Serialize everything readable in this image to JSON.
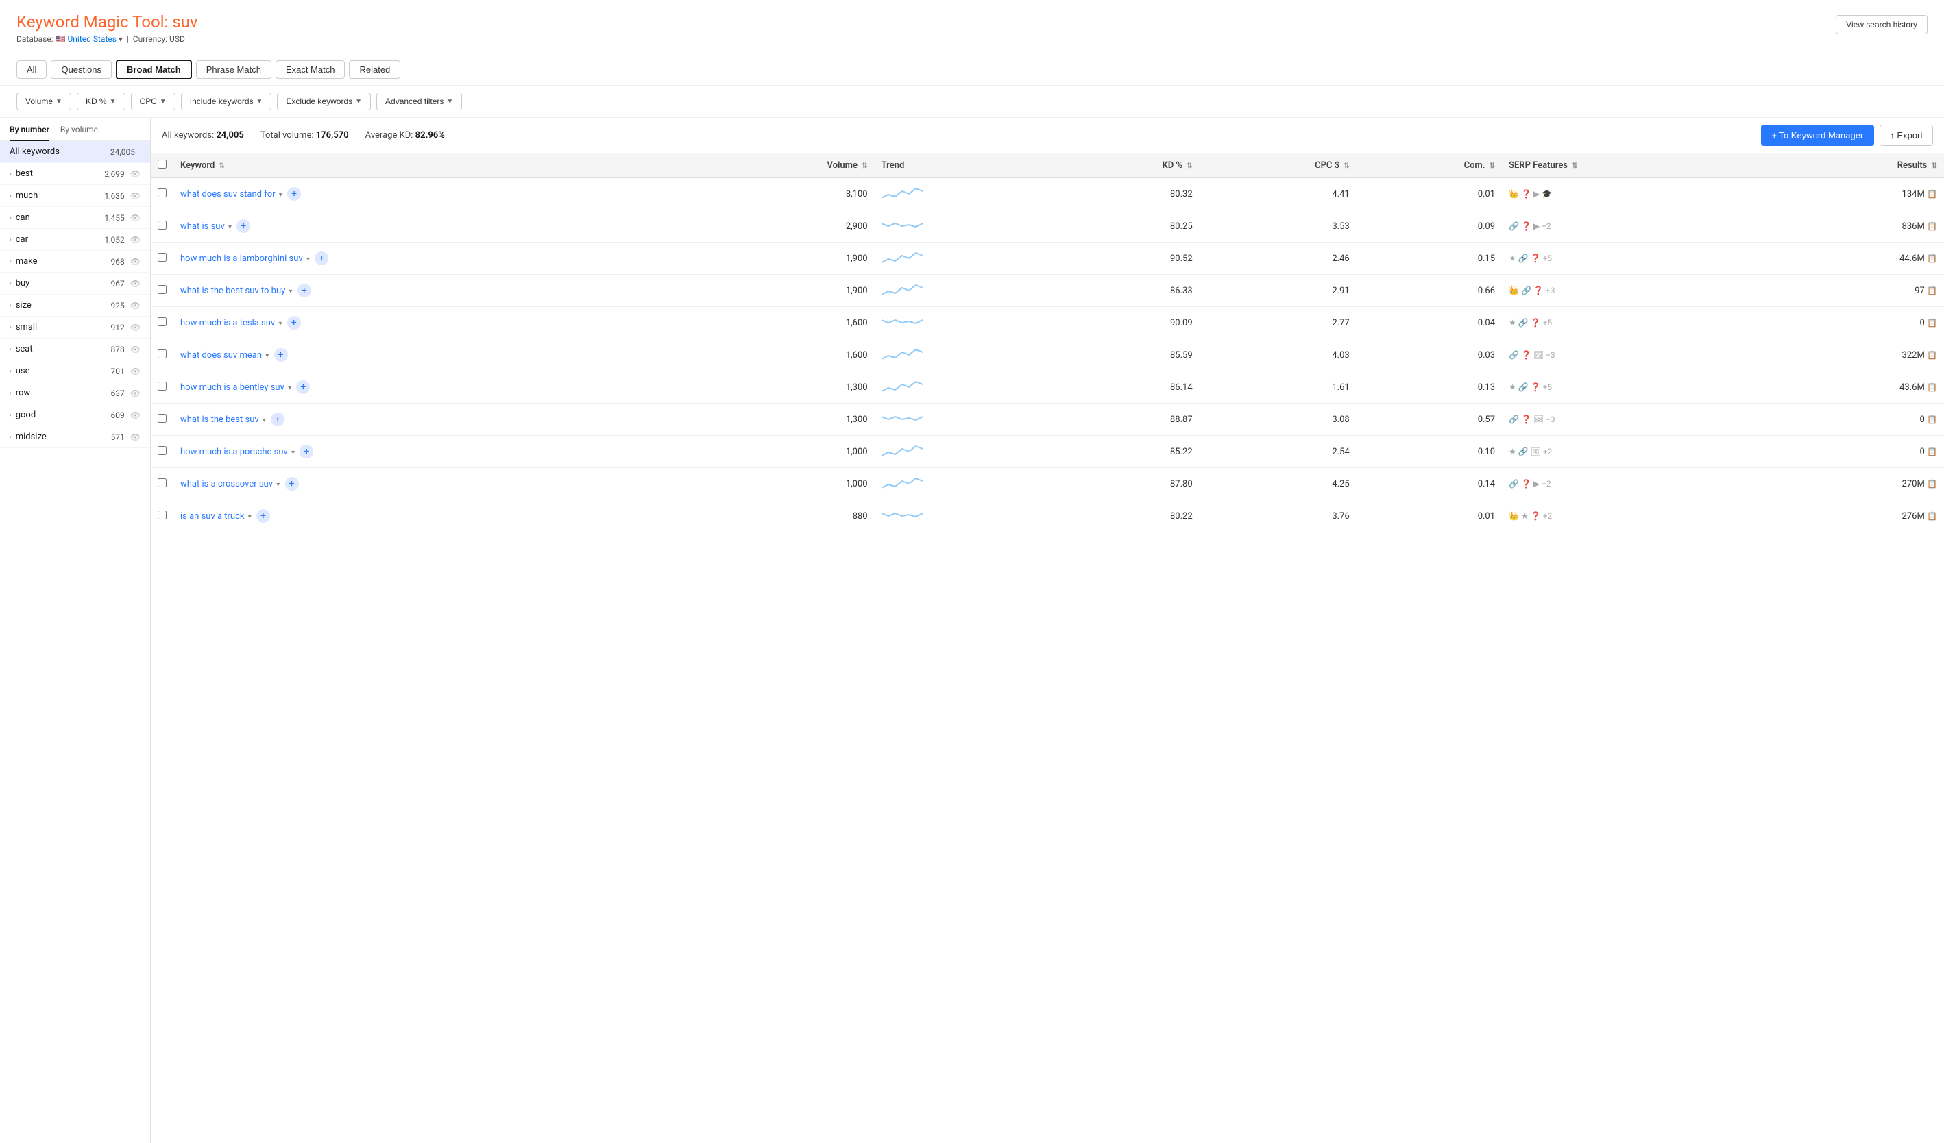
{
  "header": {
    "title_prefix": "Keyword Magic Tool: ",
    "title_keyword": "suv",
    "database_label": "Database:",
    "database_value": "United States",
    "currency_label": "Currency: USD",
    "view_history_btn": "View search history"
  },
  "tabs": [
    {
      "id": "all",
      "label": "All",
      "active": false
    },
    {
      "id": "questions",
      "label": "Questions",
      "active": true
    },
    {
      "id": "broad",
      "label": "Broad Match",
      "active": true
    },
    {
      "id": "phrase",
      "label": "Phrase Match",
      "active": false
    },
    {
      "id": "exact",
      "label": "Exact Match",
      "active": false
    },
    {
      "id": "related",
      "label": "Related",
      "active": false
    }
  ],
  "filters": [
    {
      "id": "volume",
      "label": "Volume"
    },
    {
      "id": "kd",
      "label": "KD %"
    },
    {
      "id": "cpc",
      "label": "CPC"
    },
    {
      "id": "include",
      "label": "Include keywords"
    },
    {
      "id": "exclude",
      "label": "Exclude keywords"
    },
    {
      "id": "advanced",
      "label": "Advanced filters"
    }
  ],
  "sort_tabs": [
    {
      "id": "by_number",
      "label": "By number",
      "active": true
    },
    {
      "id": "by_volume",
      "label": "By volume",
      "active": false
    }
  ],
  "sidebar": {
    "all_keywords_label": "All keywords",
    "all_keywords_count": "24,005",
    "items": [
      {
        "label": "best",
        "count": "2,699"
      },
      {
        "label": "much",
        "count": "1,636"
      },
      {
        "label": "can",
        "count": "1,455"
      },
      {
        "label": "car",
        "count": "1,052"
      },
      {
        "label": "make",
        "count": "968"
      },
      {
        "label": "buy",
        "count": "967"
      },
      {
        "label": "size",
        "count": "925"
      },
      {
        "label": "small",
        "count": "912"
      },
      {
        "label": "seat",
        "count": "878"
      },
      {
        "label": "use",
        "count": "701"
      },
      {
        "label": "row",
        "count": "637"
      },
      {
        "label": "good",
        "count": "609"
      },
      {
        "label": "midsize",
        "count": "571"
      }
    ]
  },
  "stats": {
    "all_keywords_label": "All keywords:",
    "all_keywords_value": "24,005",
    "total_volume_label": "Total volume:",
    "total_volume_value": "176,570",
    "avg_kd_label": "Average KD:",
    "avg_kd_value": "82.96%",
    "keyword_manager_btn": "+ To Keyword Manager",
    "export_btn": "↑ Export"
  },
  "table": {
    "columns": [
      {
        "id": "keyword",
        "label": "Keyword"
      },
      {
        "id": "volume",
        "label": "Volume"
      },
      {
        "id": "trend",
        "label": "Trend"
      },
      {
        "id": "kd",
        "label": "KD %"
      },
      {
        "id": "cpc",
        "label": "CPC $"
      },
      {
        "id": "com",
        "label": "Com."
      },
      {
        "id": "serp",
        "label": "SERP Features"
      },
      {
        "id": "results",
        "label": "Results"
      }
    ],
    "rows": [
      {
        "keyword": "what does suv stand for",
        "volume": "8,100",
        "kd": "80.32",
        "cpc": "4.41",
        "com": "0.01",
        "serp": "👑 ❓ ▶ 🎓",
        "results": "134M"
      },
      {
        "keyword": "what is suv",
        "volume": "2,900",
        "kd": "80.25",
        "cpc": "3.53",
        "com": "0.09",
        "serp": "🔗 ❓ ▶ +2",
        "results": "836M"
      },
      {
        "keyword": "how much is a lamborghini suv",
        "volume": "1,900",
        "kd": "90.52",
        "cpc": "2.46",
        "com": "0.15",
        "serp": "★ 🔗 ❓ +5",
        "results": "44.6M"
      },
      {
        "keyword": "what is the best suv to buy",
        "volume": "1,900",
        "kd": "86.33",
        "cpc": "2.91",
        "com": "0.66",
        "serp": "👑 🔗 ❓ +3",
        "results": "97"
      },
      {
        "keyword": "how much is a tesla suv",
        "volume": "1,600",
        "kd": "90.09",
        "cpc": "2.77",
        "com": "0.04",
        "serp": "★ 🔗 ❓ +5",
        "results": "0"
      },
      {
        "keyword": "what does suv mean",
        "volume": "1,600",
        "kd": "85.59",
        "cpc": "4.03",
        "com": "0.03",
        "serp": "🔗 ❓ 🖼 +3",
        "results": "322M"
      },
      {
        "keyword": "how much is a bentley suv",
        "volume": "1,300",
        "kd": "86.14",
        "cpc": "1.61",
        "com": "0.13",
        "serp": "★ 🔗 ❓ +5",
        "results": "43.6M"
      },
      {
        "keyword": "what is the best suv",
        "volume": "1,300",
        "kd": "88.87",
        "cpc": "3.08",
        "com": "0.57",
        "serp": "🔗 ❓ 🖼 +3",
        "results": "0"
      },
      {
        "keyword": "how much is a porsche suv",
        "volume": "1,000",
        "kd": "85.22",
        "cpc": "2.54",
        "com": "0.10",
        "serp": "★ 🔗 🖼 +2",
        "results": "0"
      },
      {
        "keyword": "what is a crossover suv",
        "volume": "1,000",
        "kd": "87.80",
        "cpc": "4.25",
        "com": "0.14",
        "serp": "🔗 ❓ ▶ +2",
        "results": "270M"
      },
      {
        "keyword": "is an suv a truck",
        "volume": "880",
        "kd": "80.22",
        "cpc": "3.76",
        "com": "0.01",
        "serp": "👑 ★ ❓ +2",
        "results": "276M"
      }
    ]
  }
}
